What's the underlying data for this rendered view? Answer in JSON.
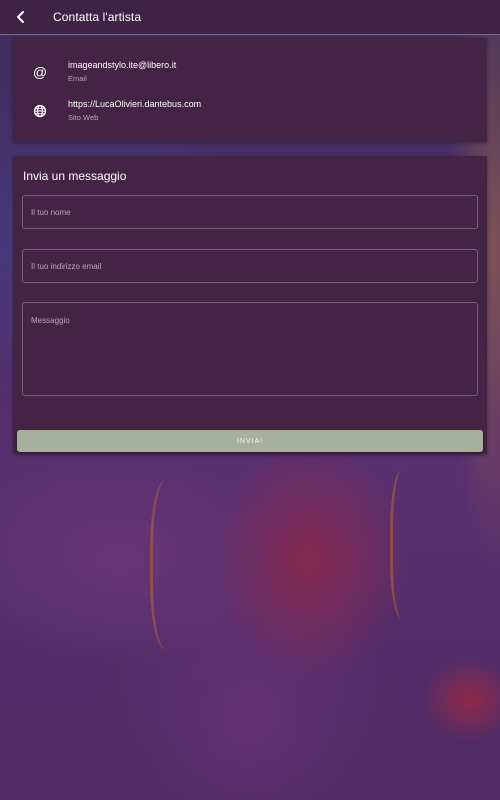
{
  "header": {
    "title": "Contatta l'artista",
    "back_icon": "chevron-left-icon"
  },
  "contacts": [
    {
      "icon": "at-sign-icon",
      "value": "imageandstylo.ite@libero.it",
      "label": "Email"
    },
    {
      "icon": "globe-icon",
      "value": "https://LucaOlivieri.dantebus.com",
      "label": "Sito Web"
    }
  ],
  "form": {
    "title": "Invia un messaggio",
    "name_placeholder": "Il tuo nome",
    "email_placeholder": "Il tuo indirizzo email",
    "message_placeholder": "Messaggio",
    "send_label": "INVIA!"
  },
  "colors": {
    "topbar": "#3f2344",
    "card": "#442444",
    "send_button": "#a7b09c"
  }
}
